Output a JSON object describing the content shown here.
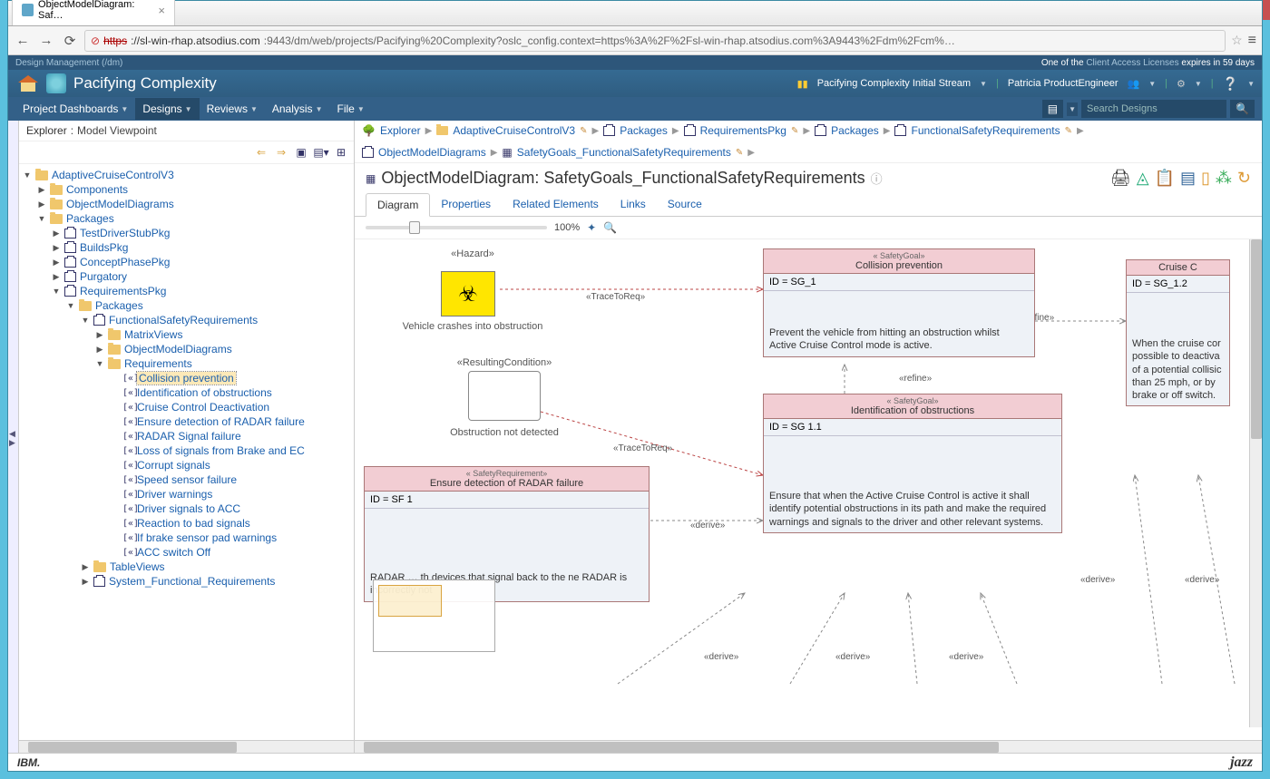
{
  "window": {
    "tab_title": "ObjectModelDiagram: Saf…",
    "url_protocol": "https",
    "url_host": "://sl-win-rhap.atsodius.com",
    "url_rest": ":9443/dm/web/projects/Pacifying%20Complexity?oslc_config.context=https%3A%2F%2Fsl-win-rhap.atsodius.com%3A9443%2Fdm%2Fcm%…"
  },
  "license": {
    "left": "Design Management (/dm)",
    "prefix": "One of the ",
    "link": "Client Access Licenses",
    "suffix": " expires in 59 days"
  },
  "header": {
    "title": "Pacifying Complexity",
    "stream": "Pacifying Complexity Initial Stream",
    "user": "Patricia ProductEngineer"
  },
  "menu": {
    "items": [
      "Project Dashboards",
      "Designs",
      "Reviews",
      "Analysis",
      "File"
    ],
    "active_index": 1,
    "search_placeholder": "Search Designs"
  },
  "explorer": {
    "title": "Explorer",
    "viewpoint": "Model Viewpoint",
    "tree": {
      "root": "AdaptiveCruiseControlV3",
      "l1": [
        "Components",
        "ObjectModelDiagrams",
        "Packages"
      ],
      "packages": [
        "TestDriverStubPkg",
        "BuildsPkg",
        "ConceptPhasePkg",
        "Purgatory",
        "RequirementsPkg"
      ],
      "req_pkg": {
        "name": "Packages",
        "fsreq": "FunctionalSafetyRequirements",
        "children": [
          "MatrixViews",
          "ObjectModelDiagrams",
          "Requirements"
        ],
        "requirements": [
          "Collision prevention",
          "Identification of obstructions",
          "Cruise Control Deactivation",
          "Ensure detection of RADAR failure",
          "RADAR Signal failure",
          "Loss of signals from Brake and EC",
          "Corrupt signals",
          "Speed sensor failure",
          "Driver warnings",
          "Driver signals to ACC",
          "Reaction to bad signals",
          "If brake sensor pad warnings",
          "ACC switch Off"
        ],
        "selected_index": 0,
        "more": [
          "TableViews",
          "System_Functional_Requirements"
        ]
      }
    }
  },
  "breadcrumb": {
    "line1": [
      "Explorer",
      "AdaptiveCruiseControlV3",
      "Packages",
      "RequirementsPkg",
      "Packages",
      "FunctionalSafetyRequirements"
    ],
    "line2": [
      "ObjectModelDiagrams",
      "SafetyGoals_FunctionalSafetyRequirements"
    ]
  },
  "diagram": {
    "title": "ObjectModelDiagram: SafetyGoals_FunctionalSafetyRequirements",
    "tabs": [
      "Diagram",
      "Properties",
      "Related Elements",
      "Links",
      "Source"
    ],
    "active_tab": 0,
    "zoom": "100%"
  },
  "canvas": {
    "hazard_stereo": "«Hazard»",
    "hazard_text": "Vehicle crashes into obstruction",
    "resulting_stereo": "«ResultingCondition»",
    "resulting_text": "Obstruction not detected",
    "trace_label": "«TraceToReq»",
    "refine_label": "«refine»",
    "derive_label": "«derive»",
    "sg1": {
      "stereo": "« SafetyGoal»",
      "name": "Collision prevention",
      "id": "ID = SG_1",
      "desc": "Prevent the vehicle from hitting an obstruction whilst Active Cruise Control mode is active."
    },
    "sg11": {
      "stereo": "« SafetyGoal»",
      "name": "Identification of obstructions",
      "id": "ID = SG 1.1",
      "desc": "Ensure that when the Active Cruise Control is active it shall identify potential obstructions in its path and make the required warnings and signals to the driver and other relevant systems."
    },
    "sg12": {
      "name": "Cruise C",
      "id": "ID = SG_1.2",
      "desc": "When the cruise cor possible to deactiva of a potential collisic than 25 mph, or by brake or off switch."
    },
    "sr1": {
      "stereo": "« SafetyRequirement»",
      "name": "Ensure detection of RADAR failure",
      "id": "ID = SF 1",
      "desc": "RADAR … th devices that signal back to the ne RADAR is incorrectly not"
    }
  },
  "footer": {
    "left": "IBM.",
    "right": "jazz"
  }
}
